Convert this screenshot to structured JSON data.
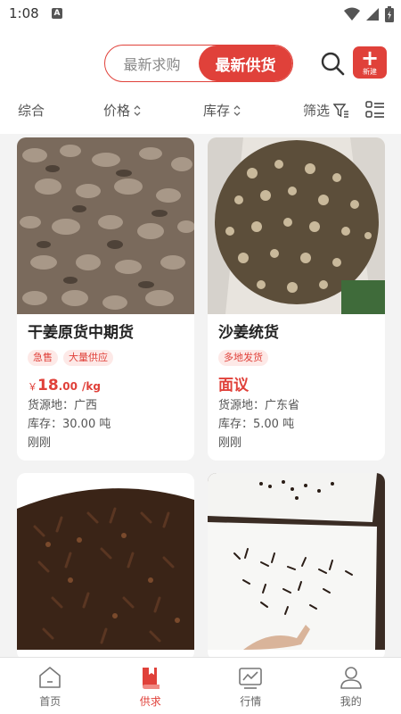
{
  "status": {
    "time": "1:08",
    "notif_icon": "A"
  },
  "header": {
    "tabs": [
      {
        "label": "最新求购",
        "active": false
      },
      {
        "label": "最新供货",
        "active": true
      }
    ],
    "new_button_label": "新建"
  },
  "filters": {
    "comprehensive": "综合",
    "price": "价格",
    "stock": "库存",
    "filter": "筛选"
  },
  "products": [
    {
      "title": "干姜原货中期货",
      "tags": [
        "急售",
        "大量供应"
      ],
      "price_currency": "￥",
      "price_int": "18",
      "price_dec": ".00",
      "price_unit": "/kg",
      "origin": "货源地：广西",
      "stock": "库存：30.00 吨",
      "time": "刚刚"
    },
    {
      "title": "沙姜统货",
      "tags": [
        "多地发货"
      ],
      "price_text": "面议",
      "origin": "货源地：广东省",
      "stock": "库存：5.00 吨",
      "time": "刚刚"
    },
    {
      "title": ""
    },
    {
      "title": ""
    }
  ],
  "nav": [
    {
      "label": "首页",
      "active": false
    },
    {
      "label": "供求",
      "active": true
    },
    {
      "label": "行情",
      "active": false
    },
    {
      "label": "我的",
      "active": false
    }
  ],
  "colors": {
    "accent": "#e0413a"
  }
}
